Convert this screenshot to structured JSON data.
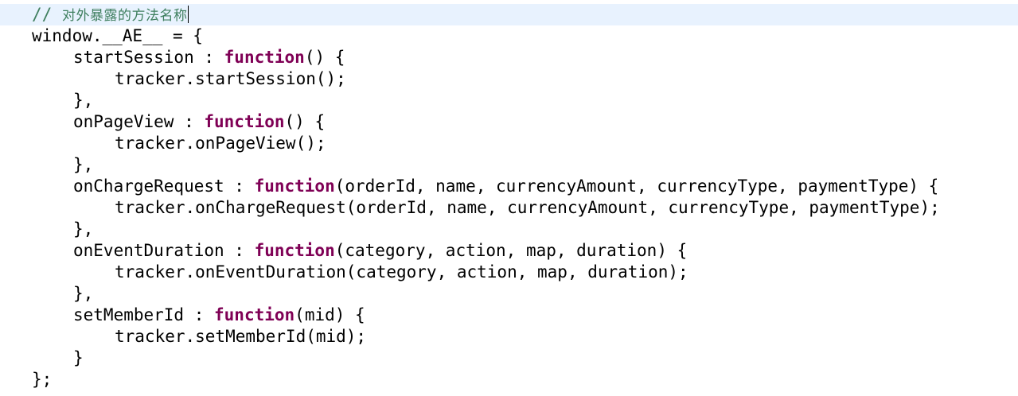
{
  "editor": {
    "current_line_color": "#e8f2fe",
    "keyword_color": "#7f0055",
    "comment_color": "#3f7f5f",
    "comment": {
      "prefix": "//",
      "text": "对外暴露的方法名称"
    },
    "lines": {
      "l2": "window.__AE__ = {",
      "l3_name": "startSession : ",
      "l3_kw": "function",
      "l3_rest": "() {",
      "l4": "tracker.startSession();",
      "l5": "},",
      "l6_name": "onPageView : ",
      "l6_kw": "function",
      "l6_rest": "() {",
      "l7": "tracker.onPageView();",
      "l8": "},",
      "l9_name": "onChargeRequest : ",
      "l9_kw": "function",
      "l9_rest": "(orderId, name, currencyAmount, currencyType, paymentType) {",
      "l10": "tracker.onChargeRequest(orderId, name, currencyAmount, currencyType, paymentType);",
      "l11": "},",
      "l12_name": "onEventDuration : ",
      "l12_kw": "function",
      "l12_rest": "(category, action, map, duration) {",
      "l13": "tracker.onEventDuration(category, action, map, duration);",
      "l14": "},",
      "l15_name": "setMemberId : ",
      "l15_kw": "function",
      "l15_rest": "(mid) {",
      "l16": "tracker.setMemberId(mid);",
      "l17": "}",
      "l18": "};"
    }
  }
}
